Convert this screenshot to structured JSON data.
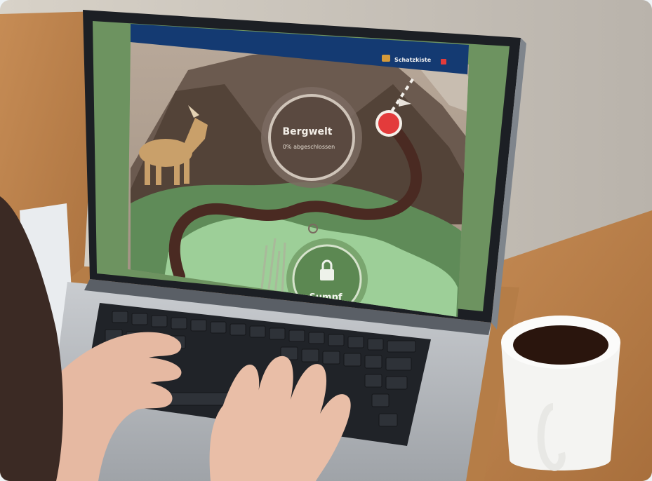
{
  "screen": {
    "header_logo_text": "",
    "header_right_label": "Schatzkiste",
    "main_level_title": "Bergwelt",
    "main_level_subtitle": "0% abgeschlossen",
    "locked_level_title": "Sumpf"
  },
  "colors": {
    "header_bar": "#143a72",
    "screen_green": "#6d9360",
    "path_brown": "#4a2a22",
    "marker_red": "#e33b3b",
    "lake_green": "#9dcf98",
    "table_wood": "#b97f47"
  },
  "icons": {
    "treasure": "treasure-chest-icon",
    "lock": "lock-icon",
    "current_position": "red-marker-icon"
  }
}
